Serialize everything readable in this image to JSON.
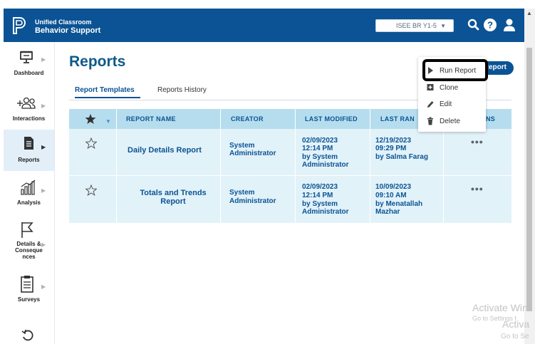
{
  "header": {
    "app_name_line1": "Unified Classroom",
    "app_name_line2": "Behavior Support",
    "school_selector": "ISEE BR Y1-5",
    "brand_color": "#0b5394"
  },
  "sidebar": {
    "items": [
      {
        "label": "Dashboard",
        "icon": "presentation-board-icon"
      },
      {
        "label": "Interactions",
        "icon": "people-plus-icon"
      },
      {
        "label": "Reports",
        "icon": "document-icon",
        "active": true
      },
      {
        "label": "Analysis",
        "icon": "bar-chart-icon"
      },
      {
        "label": "Details &",
        "label2": "Conseque",
        "label3": "nces",
        "icon": "flag-icon"
      },
      {
        "label": "Surveys",
        "icon": "clipboard-icon"
      },
      {
        "label": "",
        "icon": "history-icon"
      }
    ]
  },
  "page": {
    "title": "Reports",
    "new_report_label": "Report",
    "tabs": [
      {
        "label": "Report Templates",
        "active": true
      },
      {
        "label": "Reports History",
        "active": false
      }
    ]
  },
  "table": {
    "columns": [
      "REPORT NAME",
      "CREATOR",
      "LAST MODIFIED",
      "LAST RAN",
      "NS"
    ],
    "rows": [
      {
        "name": "Daily Details Report",
        "creator_1": "System",
        "creator_2": "Administrator",
        "modified_date": "02/09/2023",
        "modified_time": "12:14 PM",
        "modified_by_1": "by System",
        "modified_by_2": "Administrator",
        "ran_date": "12/19/2023",
        "ran_time": "09:29 PM",
        "ran_by_1": "by Salma Farag",
        "ran_by_2": ""
      },
      {
        "name_1": "Totals and Trends",
        "name_2": "Report",
        "creator_1": "System",
        "creator_2": "Administrator",
        "modified_date": "02/09/2023",
        "modified_time": "12:14 PM",
        "modified_by_1": "by System",
        "modified_by_2": "Administrator",
        "ran_date": "10/09/2023",
        "ran_time": "09:10 AM",
        "ran_by_1": "by Menatallah",
        "ran_by_2": "Mazhar"
      }
    ]
  },
  "context_menu": {
    "items": [
      {
        "label": "Run Report",
        "icon": "play-icon"
      },
      {
        "label": "Clone",
        "icon": "clone-icon"
      },
      {
        "label": "Edit",
        "icon": "pencil-icon"
      },
      {
        "label": "Delete",
        "icon": "trash-icon"
      }
    ]
  },
  "watermark": {
    "line1": "Activate Win",
    "line2": "Go to Settings t",
    "line3": "Activa",
    "line4": "Go to Se"
  }
}
